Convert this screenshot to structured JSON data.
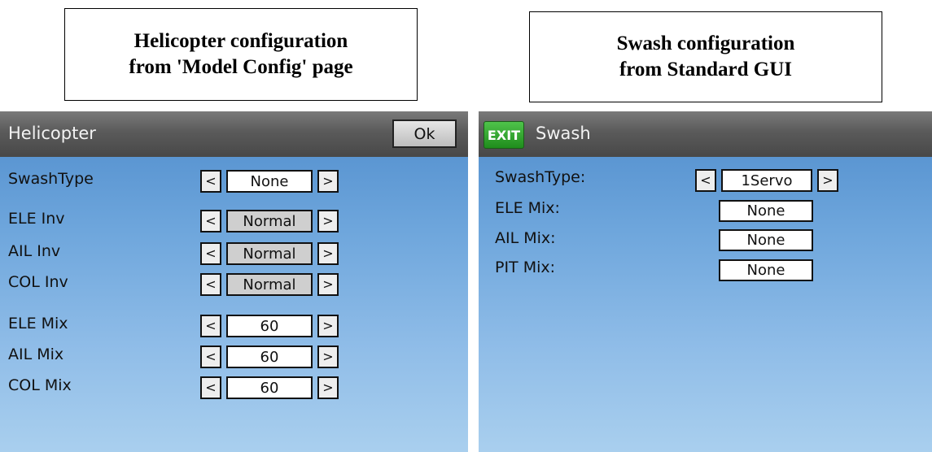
{
  "captions": {
    "left": {
      "line1": "Helicopter configuration",
      "line2": "from 'Model Config' page"
    },
    "right": {
      "line1": "Swash configuration",
      "line2": "from Standard GUI"
    }
  },
  "helicopter_screen": {
    "title": "Helicopter",
    "ok_label": "Ok",
    "prev_symbol": "<",
    "next_symbol": ">",
    "rows": [
      {
        "label": "SwashType",
        "value": "None"
      },
      {
        "label": "ELE Inv",
        "value": "Normal"
      },
      {
        "label": "AIL Inv",
        "value": "Normal"
      },
      {
        "label": "COL Inv",
        "value": "Normal"
      },
      {
        "label": "ELE Mix",
        "value": "60"
      },
      {
        "label": "AIL Mix",
        "value": "60"
      },
      {
        "label": "COL Mix",
        "value": "60"
      }
    ]
  },
  "swash_screen": {
    "exit_label": "EXIT",
    "title": "Swash",
    "prev_symbol": "<",
    "next_symbol": ">",
    "rows": [
      {
        "label": "SwashType:",
        "value": "1Servo"
      },
      {
        "label": "ELE Mix:",
        "value": "None"
      },
      {
        "label": "AIL Mix:",
        "value": "None"
      },
      {
        "label": "PIT Mix:",
        "value": "None"
      }
    ]
  }
}
